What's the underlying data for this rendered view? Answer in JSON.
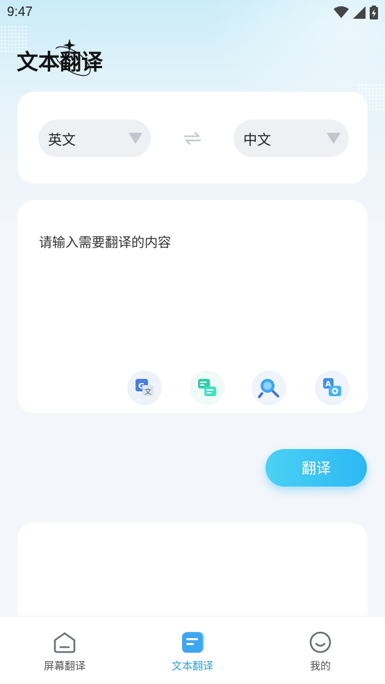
{
  "status_bar": {
    "time": "9:47"
  },
  "header": {
    "title": "文本翻译"
  },
  "language_selector": {
    "source_language": "英文",
    "target_language": "中文"
  },
  "input_area": {
    "placeholder": "请输入需要翻译的内容",
    "tools": [
      {
        "icon": "google-translate-icon"
      },
      {
        "icon": "chat-translate-icon"
      },
      {
        "icon": "search-lookup-icon"
      },
      {
        "icon": "camera-translate-icon"
      }
    ]
  },
  "translate_button": {
    "label": "翻译"
  },
  "tab_bar": {
    "tabs": [
      {
        "label": "屏幕翻译",
        "icon": "home-icon",
        "active": false
      },
      {
        "label": "文本翻译",
        "icon": "document-icon",
        "active": true
      },
      {
        "label": "我的",
        "icon": "smile-icon",
        "active": false
      }
    ]
  },
  "colors": {
    "accent": "#2aa4e8",
    "button_gradient_start": "#4bd1f3",
    "button_gradient_end": "#2cb8f5",
    "pill_background": "#eef1f4",
    "page_background": "#f3f6fa"
  }
}
